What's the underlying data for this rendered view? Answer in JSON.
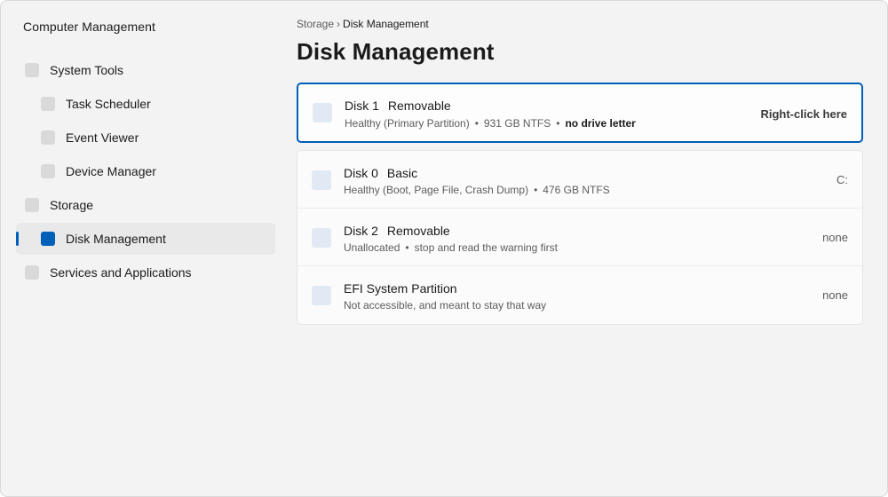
{
  "app": {
    "title": "Computer Management"
  },
  "sidebar": {
    "items": [
      {
        "label": "System Tools",
        "level": 0,
        "selected": false
      },
      {
        "label": "Task Scheduler",
        "level": 1,
        "selected": false
      },
      {
        "label": "Event Viewer",
        "level": 1,
        "selected": false
      },
      {
        "label": "Device Manager",
        "level": 1,
        "selected": false
      },
      {
        "label": "Storage",
        "level": 0,
        "selected": false
      },
      {
        "label": "Disk Management",
        "level": 1,
        "selected": true
      },
      {
        "label": "Services and Applications",
        "level": 0,
        "selected": false
      }
    ]
  },
  "breadcrumb": {
    "parent": "Storage",
    "separator": "›",
    "current": "Disk Management"
  },
  "page": {
    "title": "Disk Management"
  },
  "disks": {
    "highlighted": {
      "name": "Disk 1",
      "type": "Removable",
      "status": "Healthy (Primary Partition)",
      "dot": "•",
      "size": "931 GB NTFS",
      "letter": "no drive letter",
      "action": "Right-click here"
    },
    "rows": [
      {
        "name": "Disk 0",
        "type": "Basic",
        "detail1": "Healthy (Boot, Page File, Crash Dump)",
        "dot": "•",
        "detail2": "476 GB NTFS",
        "right": "C:"
      },
      {
        "name": "Disk 2",
        "type": "Removable",
        "detail1": "Unallocated",
        "dot": "•",
        "detail2": "stop and read the warning first",
        "right": "none"
      },
      {
        "name": "EFI System Partition",
        "type": "",
        "detail1": "Not accessible, and meant to stay that way",
        "dot": "",
        "detail2": "",
        "right": "none"
      }
    ]
  },
  "colors": {
    "accent": "#005fb8",
    "window_bg": "#f3f3f3",
    "card_bg": "#fbfbfb"
  }
}
